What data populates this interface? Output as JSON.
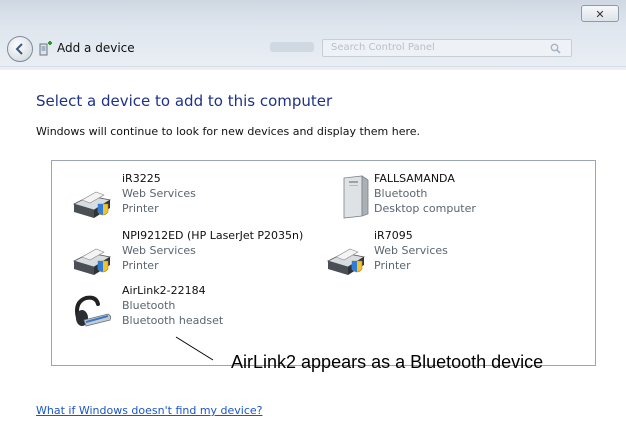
{
  "window": {
    "close_label": "✕",
    "title": "Add a device",
    "search_placeholder": "Search Control Panel"
  },
  "main": {
    "heading": "Select a device to add to this computer",
    "subtext": "Windows will continue to look for new devices and display them here."
  },
  "devices": [
    {
      "name": "iR3225",
      "type": "Web Services",
      "category": "Printer",
      "icon": "printer-icon"
    },
    {
      "name": "FALLSAMANDA",
      "type": "Bluetooth",
      "category": "Desktop computer",
      "icon": "desktop-computer-icon"
    },
    {
      "name": "NPI9212ED (HP LaserJet P2035n)",
      "type": "Web Services",
      "category": "Printer",
      "icon": "printer-icon"
    },
    {
      "name": "iR7095",
      "type": "Web Services",
      "category": "Printer",
      "icon": "printer-icon"
    },
    {
      "name": "AirLink2-22184",
      "type": "Bluetooth",
      "category": "Bluetooth headset",
      "icon": "headset-icon"
    }
  ],
  "annotation": "AirLink2 appears as a Bluetooth device",
  "help_link": "What if Windows doesn't find my device?"
}
